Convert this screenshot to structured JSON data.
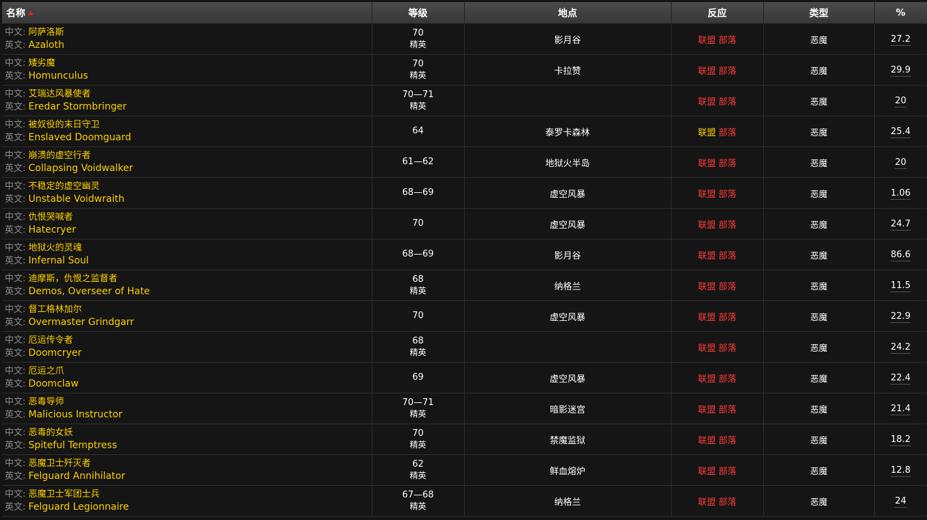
{
  "header": {
    "name": "名称",
    "level": "等级",
    "location": "地点",
    "reaction": "反应",
    "type": "类型",
    "percent": "%"
  },
  "labels": {
    "zh_prefix": "中文: ",
    "en_prefix": "英文: "
  },
  "rows": [
    {
      "zh": "阿萨洛斯",
      "en": "Azaloth",
      "level": "70",
      "elite": "精英",
      "location": "影月谷",
      "alliance": "联盟",
      "horde": "部落",
      "alliance_color": "red",
      "type": "恶魔",
      "percent": "27.2"
    },
    {
      "zh": "矮劣魔",
      "en": "Homunculus",
      "level": "70",
      "elite": "精英",
      "location": "卡拉赞",
      "alliance": "联盟",
      "horde": "部落",
      "alliance_color": "red",
      "type": "恶魔",
      "percent": "29.9"
    },
    {
      "zh": "艾瑞达风暴使者",
      "en": "Eredar Stormbringer",
      "level": "70—71",
      "elite": "精英",
      "location": "",
      "alliance": "联盟",
      "horde": "部落",
      "alliance_color": "red",
      "type": "恶魔",
      "percent": "20"
    },
    {
      "zh": "被奴役的末日守卫",
      "en": "Enslaved Doomguard",
      "level": "64",
      "elite": "",
      "location": "泰罗卡森林",
      "alliance": "联盟",
      "horde": "部落",
      "alliance_color": "yellow",
      "type": "恶魔",
      "percent": "25.4"
    },
    {
      "zh": "崩溃的虚空行者",
      "en": "Collapsing Voidwalker",
      "level": "61—62",
      "elite": "",
      "location": "地狱火半岛",
      "alliance": "联盟",
      "horde": "部落",
      "alliance_color": "red",
      "type": "恶魔",
      "percent": "20"
    },
    {
      "zh": "不稳定的虚空幽灵",
      "en": "Unstable Voidwraith",
      "level": "68—69",
      "elite": "",
      "location": "虚空风暴",
      "alliance": "联盟",
      "horde": "部落",
      "alliance_color": "red",
      "type": "恶魔",
      "percent": "1.06"
    },
    {
      "zh": "仇恨哭喊者",
      "en": "Hatecryer",
      "level": "70",
      "elite": "",
      "location": "虚空风暴",
      "alliance": "联盟",
      "horde": "部落",
      "alliance_color": "red",
      "type": "恶魔",
      "percent": "24.7"
    },
    {
      "zh": "地狱火的灵魂",
      "en": "Infernal Soul",
      "level": "68—69",
      "elite": "",
      "location": "影月谷",
      "alliance": "联盟",
      "horde": "部落",
      "alliance_color": "red",
      "type": "恶魔",
      "percent": "86.6"
    },
    {
      "zh": "迪摩斯，仇恨之监督者",
      "en": "Demos, Overseer of Hate",
      "level": "68",
      "elite": "精英",
      "location": "纳格兰",
      "alliance": "联盟",
      "horde": "部落",
      "alliance_color": "red",
      "type": "恶魔",
      "percent": "11.5"
    },
    {
      "zh": "督工格林加尔",
      "en": "Overmaster Grindgarr",
      "level": "70",
      "elite": "",
      "location": "虚空风暴",
      "alliance": "联盟",
      "horde": "部落",
      "alliance_color": "red",
      "type": "恶魔",
      "percent": "22.9"
    },
    {
      "zh": "厄运传令者",
      "en": "Doomcryer",
      "level": "68",
      "elite": "精英",
      "location": "",
      "alliance": "联盟",
      "horde": "部落",
      "alliance_color": "red",
      "type": "恶魔",
      "percent": "24.2"
    },
    {
      "zh": "厄运之爪",
      "en": "Doomclaw",
      "level": "69",
      "elite": "",
      "location": "虚空风暴",
      "alliance": "联盟",
      "horde": "部落",
      "alliance_color": "red",
      "type": "恶魔",
      "percent": "22.4"
    },
    {
      "zh": "恶毒导师",
      "en": "Malicious Instructor",
      "level": "70—71",
      "elite": "精英",
      "location": "暗影迷宫",
      "alliance": "联盟",
      "horde": "部落",
      "alliance_color": "red",
      "type": "恶魔",
      "percent": "21.4"
    },
    {
      "zh": "恶毒的女妖",
      "en": "Spiteful Temptress",
      "level": "70",
      "elite": "精英",
      "location": "禁魔监狱",
      "alliance": "联盟",
      "horde": "部落",
      "alliance_color": "red",
      "type": "恶魔",
      "percent": "18.2"
    },
    {
      "zh": "恶魔卫士歼灭者",
      "en": "Felguard Annihilator",
      "level": "62",
      "elite": "精英",
      "location": "鲜血熔炉",
      "alliance": "联盟",
      "horde": "部落",
      "alliance_color": "red",
      "type": "恶魔",
      "percent": "12.8"
    },
    {
      "zh": "恶魔卫士军团士兵",
      "en": "Felguard Legionnaire",
      "level": "67—68",
      "elite": "精英",
      "location": "纳格兰",
      "alliance": "联盟",
      "horde": "部落",
      "alliance_color": "red",
      "type": "恶魔",
      "percent": "24"
    }
  ],
  "colors": {
    "name_text": "#ffd100",
    "reaction_red": "#ff3b3b",
    "reaction_yellow": "#ffd100",
    "sort_arrow": "#e0242e"
  }
}
